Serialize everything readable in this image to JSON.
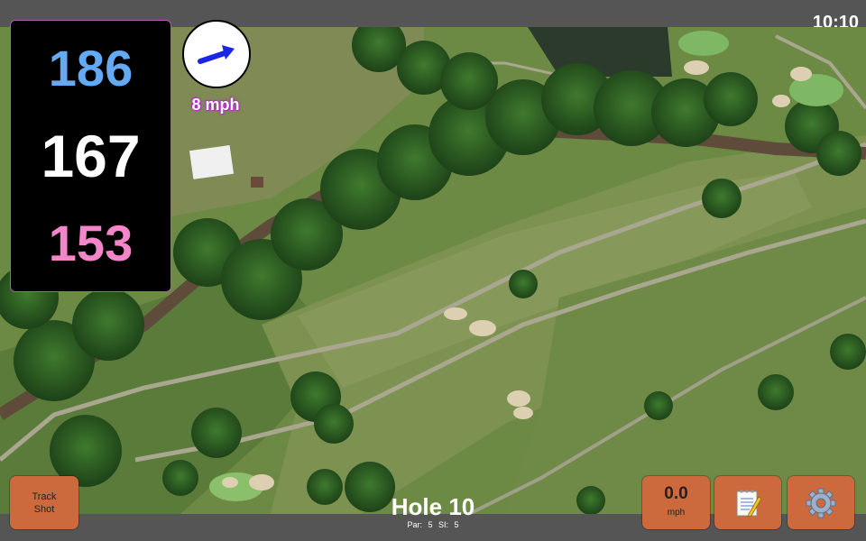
{
  "status_bar": {
    "time": "10:10"
  },
  "distances": {
    "back": "186",
    "middle": "167",
    "front": "153"
  },
  "wind": {
    "speed_label": "8 mph",
    "direction": "wind-arrow-icon"
  },
  "hole": {
    "title": "Hole 10",
    "par_label": "Par: 5",
    "si_label": "SI: 5"
  },
  "buttons": {
    "track_shot_line1": "Track",
    "track_shot_line2": "Shot",
    "speed_value": "0.0",
    "speed_unit": "mph",
    "notes_icon": "notepad-icon",
    "settings_icon": "gear-icon"
  },
  "colors": {
    "back_distance": "#64aaf2",
    "middle_distance": "#ffffff",
    "front_distance": "#f385c9",
    "button": "#cd6a3d",
    "panel_border": "#b25bb5"
  }
}
